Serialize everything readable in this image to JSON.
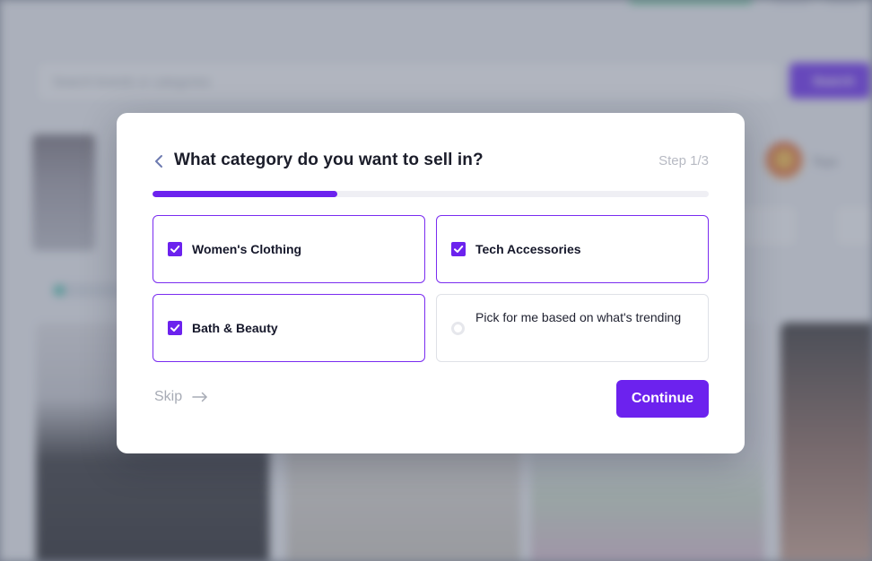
{
  "background": {
    "search_placeholder": "Search brands or categories",
    "search_button_label": "Search",
    "avatar_label": "Toys"
  },
  "modal": {
    "title": "What category do you want to sell in?",
    "step_label": "Step 1/3",
    "progress_fraction": 0.333,
    "options": [
      {
        "label": "Women's Clothing",
        "selected": true,
        "control": "checkbox"
      },
      {
        "label": "Tech Accessories",
        "selected": true,
        "control": "checkbox"
      },
      {
        "label": "Bath & Beauty",
        "selected": true,
        "control": "checkbox"
      },
      {
        "label": "Pick for me based on what's trending",
        "selected": false,
        "control": "radio"
      }
    ],
    "skip_label": "Skip",
    "continue_label": "Continue"
  },
  "colors": {
    "accent": "#6c22ee",
    "selected_border": "#7a2cf0",
    "title_text": "#1b1d2a",
    "muted_text": "#a7abb5"
  },
  "icons": {
    "back": "chevron-left-icon",
    "check": "check-icon",
    "skip": "arrow-right-icon"
  }
}
